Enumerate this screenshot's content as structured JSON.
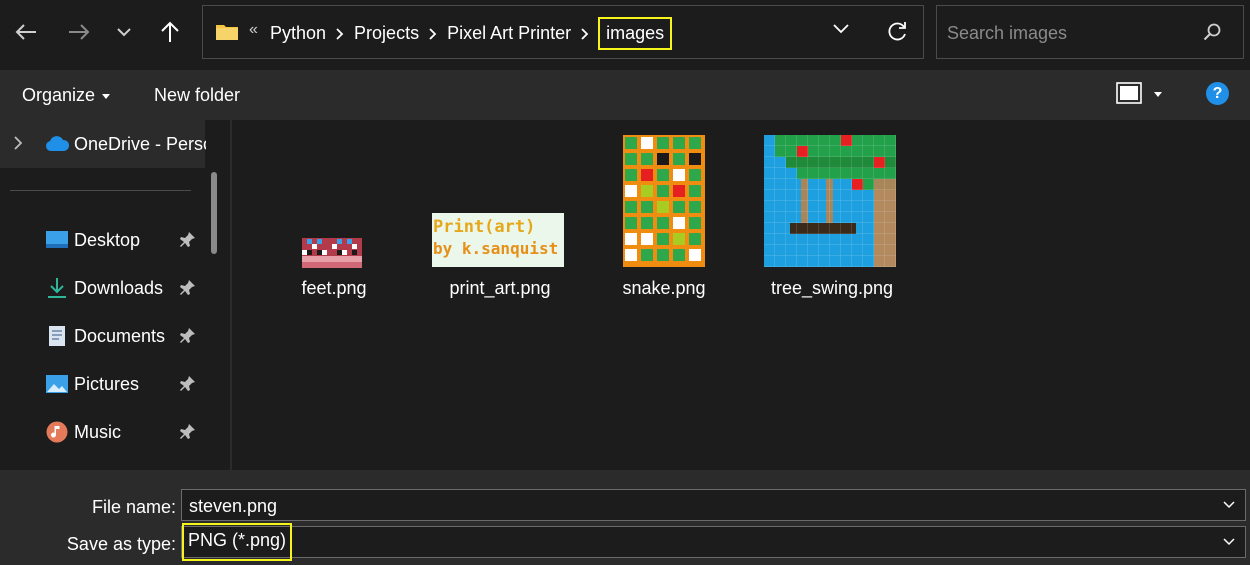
{
  "navigation": {
    "back_icon": "arrow-left-icon",
    "forward_icon": "arrow-right-icon",
    "recent_icon": "chevron-down-icon",
    "up_icon": "arrow-up-icon"
  },
  "address_bar": {
    "overflow_marker": "«",
    "breadcrumbs": [
      "Python",
      "Projects",
      "Pixel Art Printer",
      "images"
    ],
    "highlight_color": "#f5f51a"
  },
  "search": {
    "placeholder": "Search images"
  },
  "command_bar": {
    "organize_label": "Organize",
    "new_folder_label": "New folder",
    "help_label": "?"
  },
  "sidebar": {
    "onedrive_label": "OneDrive - Perso",
    "items": [
      {
        "label": "Desktop",
        "icon": "desktop-icon",
        "pinned": true
      },
      {
        "label": "Downloads",
        "icon": "download-icon",
        "pinned": true
      },
      {
        "label": "Documents",
        "icon": "document-icon",
        "pinned": true
      },
      {
        "label": "Pictures",
        "icon": "pictures-icon",
        "pinned": true
      },
      {
        "label": "Music",
        "icon": "music-icon",
        "pinned": true
      }
    ]
  },
  "files": [
    {
      "name": "feet.png"
    },
    {
      "name": "print_art.png",
      "thumb_text_line1": "Print(art)",
      "thumb_text_line2": "by k.sanquist"
    },
    {
      "name": "snake.png"
    },
    {
      "name": "tree_swing.png"
    }
  ],
  "save_panel": {
    "file_name_label": "File name:",
    "file_name_value": "steven.png",
    "save_type_label": "Save as type:",
    "save_type_value": "PNG (*.png)"
  },
  "colors": {
    "background": "#1c1c1c",
    "panel": "#2b2b2b",
    "accent": "#1f8fe8",
    "highlight": "#f5f51a"
  }
}
